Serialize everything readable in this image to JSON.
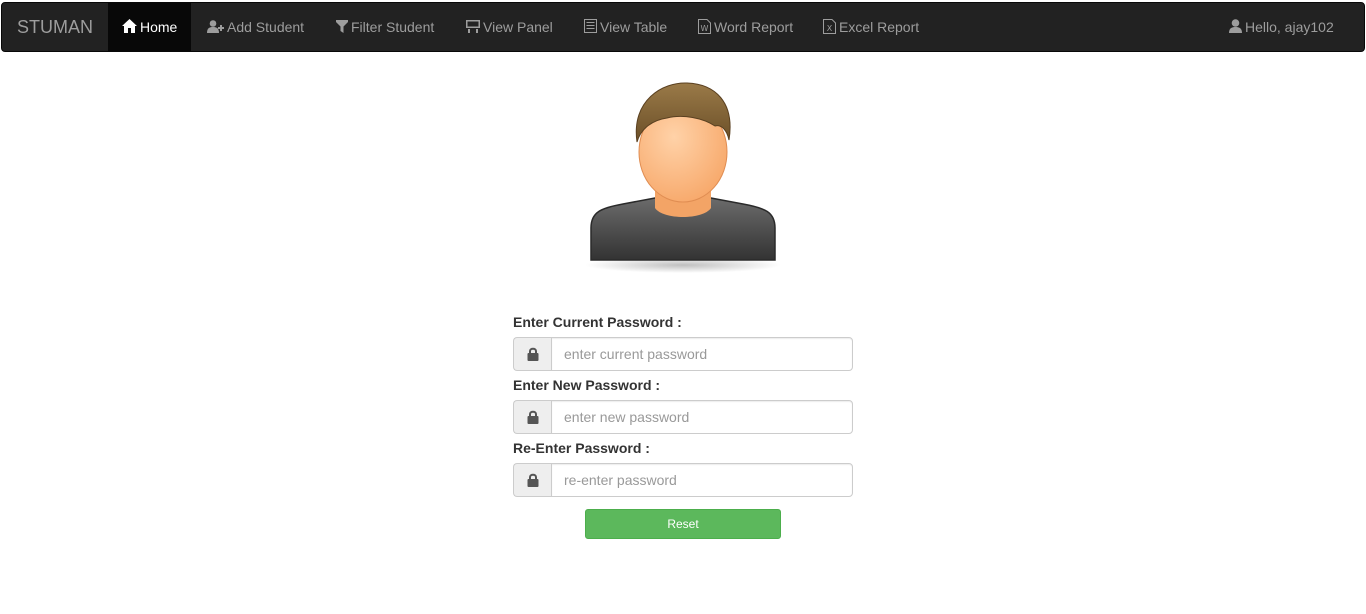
{
  "navbar": {
    "brand": "STUMAN",
    "items": [
      {
        "label": "Home",
        "icon": "home-icon",
        "active": true
      },
      {
        "label": "Add Student",
        "icon": "add-user-icon"
      },
      {
        "label": "Filter Student",
        "icon": "filter-icon"
      },
      {
        "label": "View Panel",
        "icon": "panel-icon"
      },
      {
        "label": "View Table",
        "icon": "table-icon"
      },
      {
        "label": "Word Report",
        "icon": "word-file-icon"
      },
      {
        "label": "Excel Report",
        "icon": "excel-file-icon"
      }
    ],
    "user": {
      "greeting": "Hello, ajay102",
      "icon": "user-icon"
    }
  },
  "form": {
    "current": {
      "label": "Enter Current Password :",
      "placeholder": "enter current password",
      "value": ""
    },
    "new": {
      "label": "Enter New Password :",
      "placeholder": "enter new password",
      "value": ""
    },
    "reenter": {
      "label": "Re-Enter Password :",
      "placeholder": "re-enter password",
      "value": ""
    },
    "lock_icon": "lock-icon",
    "reset_label": "Reset"
  },
  "colors": {
    "navbar_bg": "#222222",
    "navbar_active": "#080808",
    "nav_text": "#9d9d9d",
    "button_success": "#5cb85c"
  }
}
